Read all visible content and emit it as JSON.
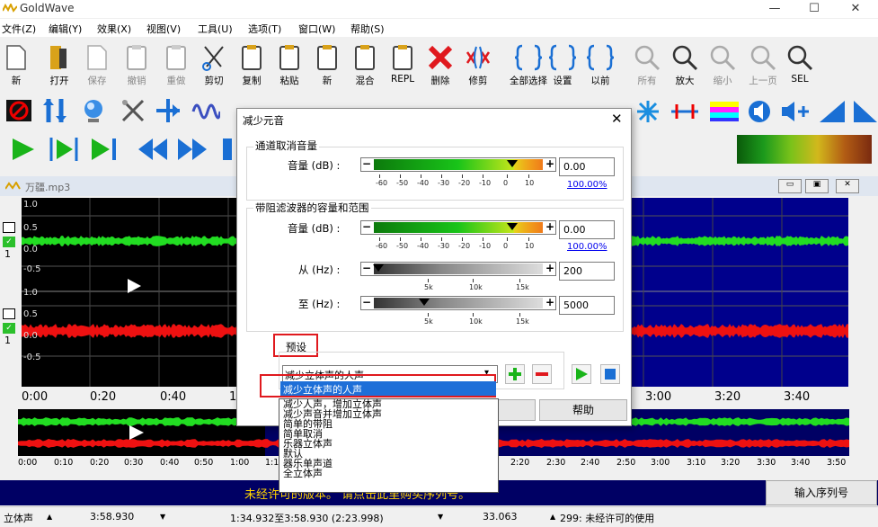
{
  "app": {
    "title": "GoldWave"
  },
  "window_buttons": {
    "min": "—",
    "max": "☐",
    "close": "✕"
  },
  "menu": [
    "文件(Z)",
    "编辑(Y)",
    "效果(X)",
    "视图(V)",
    "工具(U)",
    "选项(T)",
    "窗口(W)",
    "帮助(S)"
  ],
  "toolbar": [
    {
      "label": "新",
      "icon": "new-doc-icon",
      "enabled": true
    },
    {
      "label": "打开",
      "icon": "open-folder-icon",
      "enabled": true
    },
    {
      "label": "保存",
      "icon": "save-disk-icon",
      "enabled": false
    },
    {
      "label": "撤销",
      "icon": "undo-icon",
      "enabled": false
    },
    {
      "label": "重做",
      "icon": "redo-icon",
      "enabled": false
    },
    {
      "label": "剪切",
      "icon": "scissors-icon",
      "enabled": true
    },
    {
      "label": "复制",
      "icon": "copy-icon",
      "enabled": true
    },
    {
      "label": "粘贴",
      "icon": "paste-icon",
      "enabled": true
    },
    {
      "label": "新",
      "icon": "paste-new-icon",
      "enabled": true
    },
    {
      "label": "混合",
      "icon": "mix-icon",
      "enabled": true
    },
    {
      "label": "REPL",
      "icon": "replace-icon",
      "enabled": true
    },
    {
      "label": "删除",
      "icon": "delete-x-icon",
      "enabled": true
    },
    {
      "label": "修剪",
      "icon": "trim-icon",
      "enabled": true
    },
    {
      "label": "全部选择",
      "icon": "select-all-icon",
      "enabled": true
    },
    {
      "label": "设置",
      "icon": "set-123-icon",
      "enabled": true
    },
    {
      "label": "以前",
      "icon": "previous-icon",
      "enabled": true
    },
    {
      "label": "所有",
      "icon": "zoom-all-icon",
      "enabled": false
    },
    {
      "label": "放大",
      "icon": "zoom-in-icon",
      "enabled": true
    },
    {
      "label": "缩小",
      "icon": "zoom-out-icon",
      "enabled": false
    },
    {
      "label": "上一页",
      "icon": "zoom-prev-icon",
      "enabled": false
    },
    {
      "label": "SEL",
      "icon": "zoom-sel-icon",
      "enabled": true
    }
  ],
  "wave_window": {
    "title": "万疆.mp3",
    "y_labels_top": [
      "1.0",
      "0.5",
      "0.0",
      "-0.5"
    ],
    "y_labels_bottom": [
      "1.0",
      "0.5",
      "0.0",
      "-0.5"
    ],
    "time_labels": [
      "0:00",
      "0:20",
      "0:40",
      "1",
      "3:00",
      "3:20",
      "3:40"
    ],
    "overview_labels": [
      "0:00",
      "0:10",
      "0:20",
      "0:30",
      "0:40",
      "0:50",
      "1:00",
      "1:1",
      "2:20",
      "2:30",
      "2:40",
      "2:50",
      "3:00",
      "3:10",
      "3:20",
      "3:30",
      "3:40",
      "3:50"
    ],
    "channel_marker": "1"
  },
  "unregistered": {
    "text": "未经许可的版本。 请点击此里购买序列号。",
    "button": "输入序列号"
  },
  "status": {
    "mode": "立体声",
    "length": "3:58.930",
    "selection": "1:34.932至3:58.930 (2:23.998)",
    "pos": "33.063",
    "message": "299: 未经许可的使用"
  },
  "dialog": {
    "title": "减少元音",
    "close": "✕",
    "group1": {
      "label": "通道取消音量",
      "vol_label": "音量 (dB) :",
      "value": "0.00",
      "pct": "100.00%",
      "scale": [
        "-60",
        "-50",
        "-40",
        "-30",
        "-20",
        "-10",
        "0",
        "10"
      ]
    },
    "group2": {
      "label": "带阻滤波器的容量和范围",
      "vol_label": "音量 (dB) :",
      "value": "0.00",
      "pct": "100.00%",
      "scale": [
        "-60",
        "-50",
        "-40",
        "-30",
        "-20",
        "-10",
        "0",
        "10"
      ],
      "from_label": "从 (Hz) :",
      "from_value": "200",
      "to_label": "至 (Hz) :",
      "to_value": "5000",
      "hz_scale": [
        "5k",
        "10k",
        "15k"
      ]
    },
    "preset_label": "预设",
    "preset_selected": "减少立体声的人声",
    "preset_options": [
      "减少立体声的人声",
      "减少人声，增加立体声",
      "减少声音并增加立体声",
      "简单的带阻",
      "简单取消",
      "乐器立体声",
      "默认",
      "器乐单声道",
      "全立体声"
    ],
    "buttons": {
      "cancel": "消",
      "help": "帮助"
    }
  },
  "colors": {
    "accent_red": "#e0191e",
    "wave_green": "#22dd22",
    "wave_red": "#ee1111",
    "overview_bg": "#000064",
    "unreg_text": "#ffd400"
  }
}
